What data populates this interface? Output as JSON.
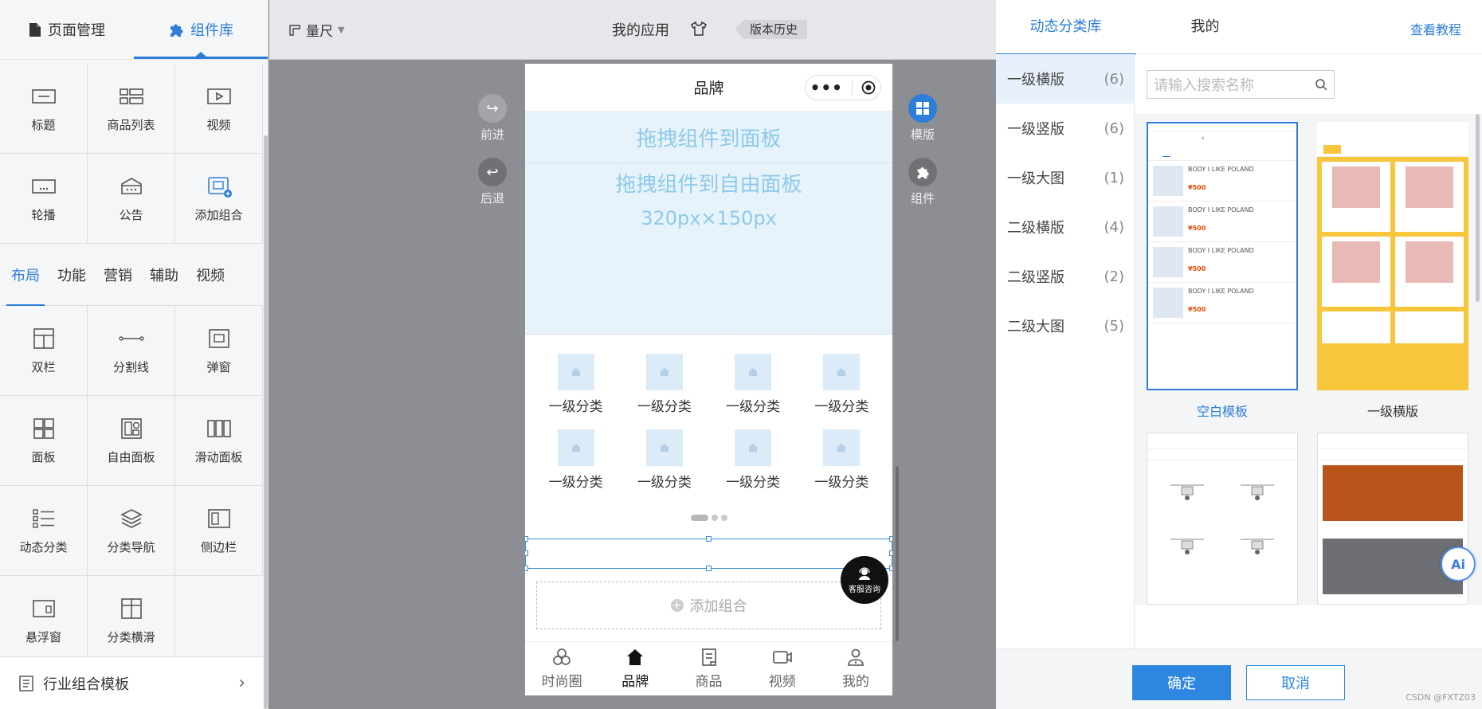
{
  "left_panel": {
    "tabs": [
      {
        "label": "页面管理",
        "icon": "page-icon"
      },
      {
        "label": "组件库",
        "icon": "puzzle-icon"
      }
    ],
    "top_components": [
      {
        "label": "标题",
        "icon": "title-icon"
      },
      {
        "label": "商品列表",
        "icon": "product-list-icon"
      },
      {
        "label": "视频",
        "icon": "video-icon"
      },
      {
        "label": "轮播",
        "icon": "carousel-icon"
      },
      {
        "label": "公告",
        "icon": "notice-icon"
      },
      {
        "label": "添加组合",
        "icon": "add-combo-icon"
      }
    ],
    "category_tabs": [
      "布局",
      "功能",
      "营销",
      "辅助",
      "视频"
    ],
    "layout_components": [
      {
        "label": "双栏",
        "icon": "two-column-icon"
      },
      {
        "label": "分割线",
        "icon": "divider-icon"
      },
      {
        "label": "弹窗",
        "icon": "popup-icon"
      },
      {
        "label": "面板",
        "icon": "panel-icon"
      },
      {
        "label": "自由面板",
        "icon": "free-panel-icon"
      },
      {
        "label": "滑动面板",
        "icon": "slide-panel-icon"
      },
      {
        "label": "动态分类",
        "icon": "dynamic-category-icon"
      },
      {
        "label": "分类导航",
        "icon": "category-nav-icon"
      },
      {
        "label": "侧边栏",
        "icon": "sidebar-icon"
      },
      {
        "label": "悬浮窗",
        "icon": "float-window-icon"
      },
      {
        "label": "分类横滑",
        "icon": "category-slide-icon"
      }
    ],
    "bottom_bar": "行业组合模板"
  },
  "topbar": {
    "ruler": "量尺",
    "app_title": "我的应用",
    "history": "版本历史"
  },
  "canvas": {
    "forward": "前进",
    "back": "后退",
    "template": "模版",
    "component": "组件"
  },
  "phone": {
    "title": "品牌",
    "drop_panel": "拖拽组件到面板",
    "drop_free_panel": "拖拽组件到自由面板",
    "free_panel_size": "320px×150px",
    "categories": [
      "一级分类",
      "一级分类",
      "一级分类",
      "一级分类",
      "一级分类",
      "一级分类",
      "一级分类",
      "一级分类"
    ],
    "add_combo": "添加组合",
    "service": "客服咨询",
    "tabbar": [
      {
        "label": "时尚圈",
        "icon": "circles-icon"
      },
      {
        "label": "品牌",
        "icon": "home-icon"
      },
      {
        "label": "商品",
        "icon": "document-icon"
      },
      {
        "label": "视频",
        "icon": "video-camera-icon"
      },
      {
        "label": "我的",
        "icon": "user-icon"
      }
    ]
  },
  "right_panel": {
    "tabs": [
      "动态分类库",
      "我的"
    ],
    "tutorial": "查看教程",
    "search_placeholder": "请输入搜索名称",
    "categories": [
      {
        "label": "一级横版",
        "count": "(6)"
      },
      {
        "label": "一级竖版",
        "count": "(6)"
      },
      {
        "label": "一级大图",
        "count": "(1)"
      },
      {
        "label": "二级横版",
        "count": "(4)"
      },
      {
        "label": "二级竖版",
        "count": "(2)"
      },
      {
        "label": "二级大图",
        "count": "(5)"
      }
    ],
    "templates": [
      {
        "label": "空白模板"
      },
      {
        "label": "一级横版"
      }
    ],
    "confirm": "确定",
    "cancel": "取消",
    "watermark": "CSDN @FXTZ03"
  },
  "colors": {
    "accent": "#2d7ed8",
    "drop_text": "#8ecae9",
    "drop_bg": "#e7f3fb",
    "price": "#e84a00"
  }
}
